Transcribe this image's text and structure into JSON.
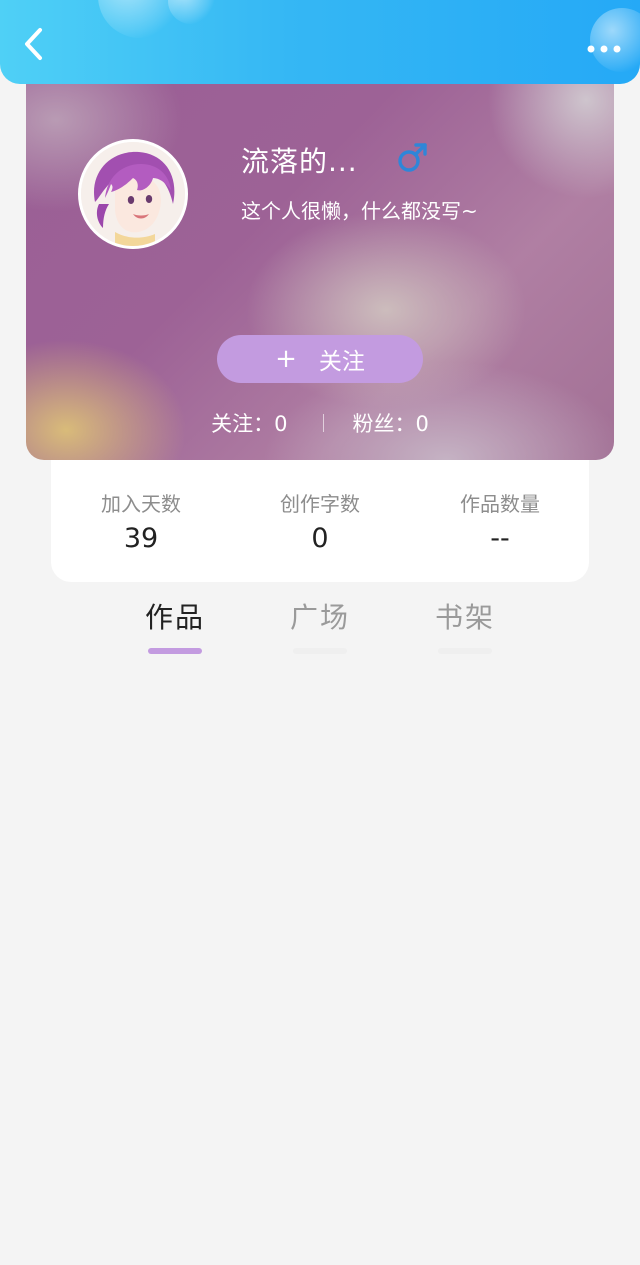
{
  "header": {
    "back_icon": "chevron-left-icon",
    "more_icon": "more-dots-icon",
    "gradient_start": "#4fd0f6",
    "gradient_end": "#25a9f6"
  },
  "profile": {
    "nickname": "流落的...",
    "gender_icon": "male-icon",
    "gender_color": "#2f86d8",
    "bio": "这个人很懒，什么都没写~",
    "follow_plus": "+",
    "follow_label": "关注",
    "follow_color": "#c39be0",
    "following_label": "关注：0",
    "followers_label": "粉丝：0"
  },
  "stats": [
    {
      "label": "加入天数",
      "value": "39"
    },
    {
      "label": "创作字数",
      "value": "0"
    },
    {
      "label": "作品数量",
      "value": "--"
    }
  ],
  "tabs": [
    {
      "label": "作品",
      "active": true
    },
    {
      "label": "广场",
      "active": false
    },
    {
      "label": "书架",
      "active": false
    }
  ],
  "colors": {
    "page_background": "#f4f4f4",
    "accent": "#c39be0"
  }
}
